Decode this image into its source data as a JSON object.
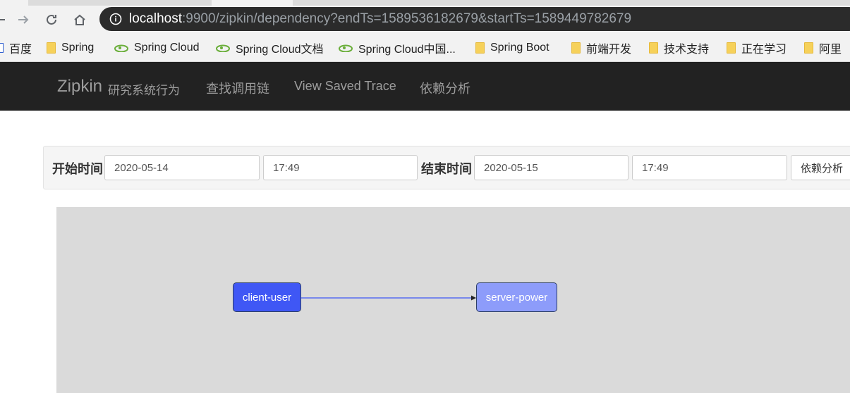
{
  "browser": {
    "url_host": "localhost",
    "url_rest": ":9900/zipkin/dependency?endTs=1589536182679&startTs=1589449782679",
    "bookmarks": [
      {
        "label": "百度",
        "icon": "baidu-icon"
      },
      {
        "label": "Spring",
        "icon": "folder-icon"
      },
      {
        "label": "Spring Cloud",
        "icon": "cloud-icon"
      },
      {
        "label": "Spring Cloud文档",
        "icon": "cloud-icon"
      },
      {
        "label": "Spring Cloud中国...",
        "icon": "cloud-icon"
      },
      {
        "label": "Spring Boot",
        "icon": "folder-icon"
      },
      {
        "label": "前端开发",
        "icon": "folder-icon"
      },
      {
        "label": "技术支持",
        "icon": "folder-icon"
      },
      {
        "label": "正在学习",
        "icon": "folder-icon"
      },
      {
        "label": "阿里",
        "icon": "folder-icon"
      }
    ]
  },
  "navbar": {
    "brand": "Zipkin",
    "brand_sub": "研究系统行为",
    "links": [
      "查找调用链",
      "View Saved Trace",
      "依赖分析"
    ]
  },
  "form": {
    "start_label": "开始时间",
    "start_date": "2020-05-14",
    "start_time": "17:49",
    "end_label": "结束时间",
    "end_date": "2020-05-15",
    "end_time": "17:49",
    "submit_label": "依赖分析"
  },
  "graph": {
    "nodes": [
      {
        "id": "client-user",
        "label": "client-user",
        "color": "#3f57f5"
      },
      {
        "id": "server-power",
        "label": "server-power",
        "color": "#8d9cfa"
      }
    ],
    "edges": [
      {
        "from": "client-user",
        "to": "server-power",
        "color": "#3f57f5"
      }
    ]
  }
}
